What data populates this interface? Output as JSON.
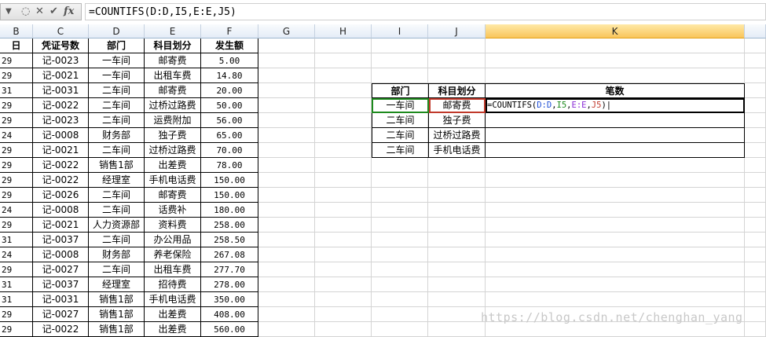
{
  "formula_bar": {
    "formula": "=COUNTIFS(D:D,I5,E:E,J5)",
    "fx_label": "fx"
  },
  "columns": [
    "B",
    "C",
    "D",
    "E",
    "F",
    "G",
    "H",
    "I",
    "J",
    "K"
  ],
  "active_column": "K",
  "sheet_headers": {
    "b": "日",
    "c": "凭证号数",
    "d": "部门",
    "e": "科目划分",
    "f": "发生额"
  },
  "rows": [
    {
      "b": "29",
      "c": "记-0023",
      "d": "一车间",
      "e": "邮寄费",
      "f": "5.00"
    },
    {
      "b": "29",
      "c": "记-0021",
      "d": "一车间",
      "e": "出租车费",
      "f": "14.80"
    },
    {
      "b": "31",
      "c": "记-0031",
      "d": "二车间",
      "e": "邮寄费",
      "f": "20.00"
    },
    {
      "b": "29",
      "c": "记-0022",
      "d": "二车间",
      "e": "过桥过路费",
      "f": "50.00"
    },
    {
      "b": "29",
      "c": "记-0023",
      "d": "二车间",
      "e": "运费附加",
      "f": "56.00"
    },
    {
      "b": "24",
      "c": "记-0008",
      "d": "财务部",
      "e": "独子费",
      "f": "65.00"
    },
    {
      "b": "29",
      "c": "记-0021",
      "d": "二车间",
      "e": "过桥过路费",
      "f": "70.00"
    },
    {
      "b": "29",
      "c": "记-0022",
      "d": "销售1部",
      "e": "出差费",
      "f": "78.00"
    },
    {
      "b": "29",
      "c": "记-0022",
      "d": "经理室",
      "e": "手机电话费",
      "f": "150.00"
    },
    {
      "b": "29",
      "c": "记-0026",
      "d": "二车间",
      "e": "邮寄费",
      "f": "150.00"
    },
    {
      "b": "24",
      "c": "记-0008",
      "d": "二车间",
      "e": "话费补",
      "f": "180.00"
    },
    {
      "b": "29",
      "c": "记-0021",
      "d": "人力资源部",
      "e": "资料费",
      "f": "258.00"
    },
    {
      "b": "31",
      "c": "记-0037",
      "d": "二车间",
      "e": "办公用品",
      "f": "258.50"
    },
    {
      "b": "24",
      "c": "记-0008",
      "d": "财务部",
      "e": "养老保险",
      "f": "267.08"
    },
    {
      "b": "29",
      "c": "记-0027",
      "d": "二车间",
      "e": "出租车费",
      "f": "277.70"
    },
    {
      "b": "31",
      "c": "记-0037",
      "d": "经理室",
      "e": "招待费",
      "f": "278.00"
    },
    {
      "b": "31",
      "c": "记-0031",
      "d": "销售1部",
      "e": "手机电话费",
      "f": "350.00"
    },
    {
      "b": "29",
      "c": "记-0027",
      "d": "销售1部",
      "e": "出差费",
      "f": "408.00"
    },
    {
      "b": "29",
      "c": "记-0022",
      "d": "销售1部",
      "e": "出差费",
      "f": "560.00"
    }
  ],
  "lookup": {
    "headers": {
      "i": "部门",
      "j": "科目划分",
      "k": "笔数"
    },
    "rows": [
      {
        "i": "一车间",
        "j": "邮寄费"
      },
      {
        "i": "二车间",
        "j": "独子费"
      },
      {
        "i": "二车间",
        "j": "过桥过路费"
      },
      {
        "i": "二车间",
        "j": "手机电话费"
      }
    ],
    "editing_formula": {
      "prefix": "=COUNTIFS(",
      "ref1": "D:D",
      "sep1": ",",
      "ref2": "I5",
      "sep2": ",",
      "ref3": "E:E",
      "sep3": ",",
      "ref4": "J5",
      "suffix": ")"
    }
  },
  "watermark": "https://blog.csdn.net/chenghan_yang",
  "colors": {
    "active_header": "#f9c55a",
    "ref_d": "#1f4fd6",
    "ref_i": "#1d8a1d",
    "ref_e": "#8a2bd6",
    "ref_j": "#c0392b"
  }
}
